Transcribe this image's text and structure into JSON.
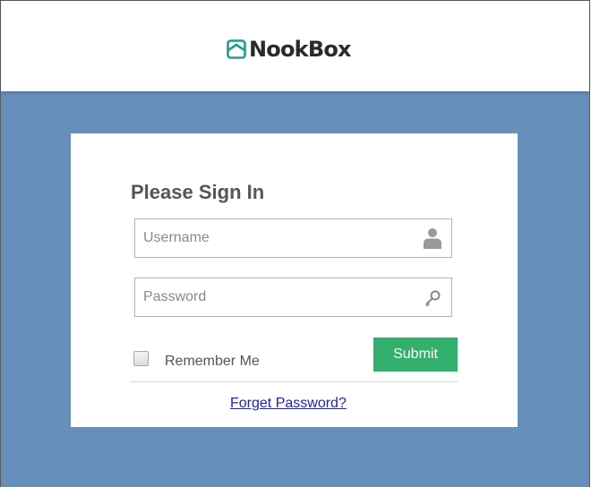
{
  "header": {
    "logo_text": "NookBox"
  },
  "login": {
    "title": "Please Sign In",
    "username": {
      "placeholder": "Username",
      "value": "",
      "icon": "user-icon"
    },
    "password": {
      "placeholder": "Password",
      "value": "",
      "icon": "key-icon"
    },
    "remember_label": "Remember Me",
    "remember_checked": false,
    "submit_label": "Submit",
    "forgot_label": "Forget Password?"
  },
  "colors": {
    "background": "#6690bb",
    "submit": "#33b06e",
    "logo_accent": "#1f9e8a",
    "link": "#2323a8"
  }
}
